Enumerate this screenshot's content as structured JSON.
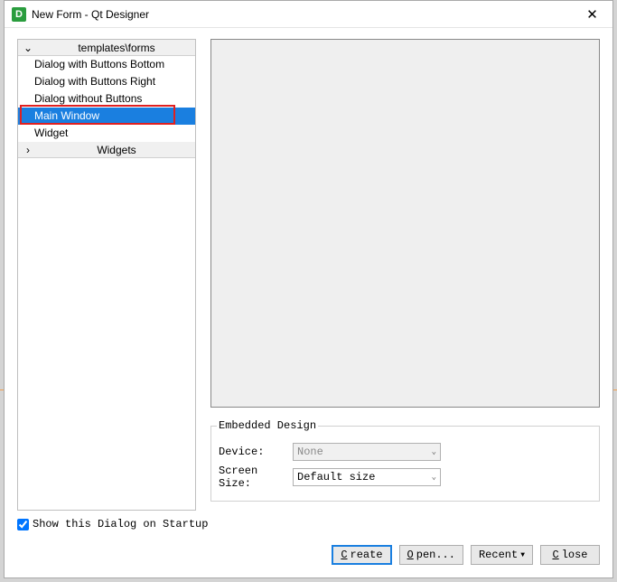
{
  "window": {
    "title": "New Form - Qt Designer",
    "icon_letter": "D"
  },
  "tree": {
    "sections": [
      {
        "label": "templates\\forms",
        "expanded": true,
        "items": [
          {
            "label": "Dialog with Buttons Bottom",
            "selected": false
          },
          {
            "label": "Dialog with Buttons Right",
            "selected": false
          },
          {
            "label": "Dialog without Buttons",
            "selected": false
          },
          {
            "label": "Main Window",
            "selected": true
          },
          {
            "label": "Widget",
            "selected": false
          }
        ]
      },
      {
        "label": "Widgets",
        "expanded": false
      }
    ]
  },
  "embedded": {
    "legend": "Embedded Design",
    "device_label": "Device:",
    "device_value": "None",
    "screen_label": "Screen Size:",
    "screen_value": "Default size"
  },
  "footer": {
    "checkbox_label": "Show this Dialog on Startup",
    "checkbox_checked": true,
    "buttons": {
      "create": "Create",
      "open": "Open...",
      "recent": "Recent",
      "close": "Close"
    }
  }
}
